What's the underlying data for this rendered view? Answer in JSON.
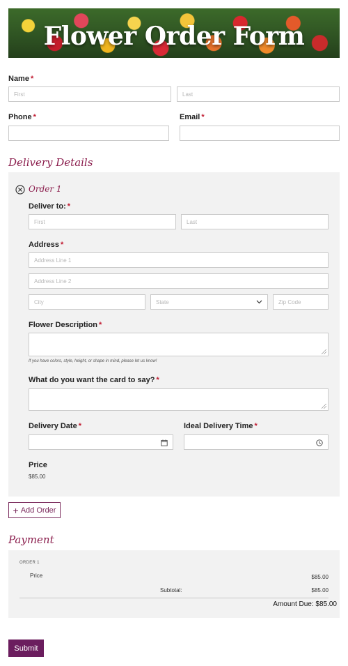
{
  "banner": {
    "title": "Flower Order Form"
  },
  "customer": {
    "name_label": "Name",
    "name_first_placeholder": "First",
    "name_last_placeholder": "Last",
    "phone_label": "Phone",
    "email_label": "Email",
    "required_mark": "*"
  },
  "delivery": {
    "section_title": "Delivery Details",
    "order_title": "Order 1",
    "deliver_to_label": "Deliver to:",
    "first_placeholder": "First",
    "last_placeholder": "Last",
    "address_label": "Address",
    "address1_placeholder": "Address Line 1",
    "address2_placeholder": "Address Line 2",
    "city_placeholder": "City",
    "state_value": "State",
    "zip_placeholder": "Zip Code",
    "flower_label": "Flower Description",
    "flower_help": "If you have colors, style, height, or shape in mind, please let us know!",
    "card_label": "What do you want the card to say?",
    "date_label": "Delivery Date",
    "time_label": "Ideal Delivery Time",
    "price_label": "Price",
    "price_value": "$85.00"
  },
  "add_order_label": "Add Order",
  "payment": {
    "section_title": "Payment",
    "order_heading": "ORDER 1",
    "price_label": "Price",
    "price_value": "$85.00",
    "subtotal_label": "Subtotal:",
    "subtotal_value": "$85.00",
    "amount_due": "Amount Due: $85.00"
  },
  "submit_label": "Submit",
  "colors": {
    "accent": "#8b1e4d",
    "button": "#6b1d5e",
    "required": "#c0182e",
    "panel": "#f2f2f2"
  }
}
